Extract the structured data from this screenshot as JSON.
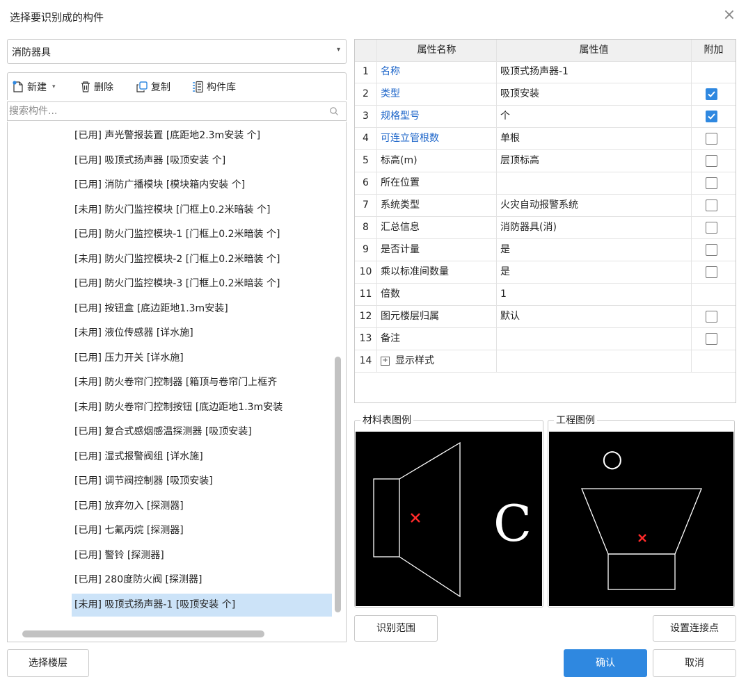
{
  "dialog": {
    "title": "选择要识别成的构件",
    "close_icon": "×"
  },
  "category": {
    "value": "消防器具"
  },
  "toolbar": {
    "new": "新建",
    "delete": "删除",
    "copy": "复制",
    "library": "构件库"
  },
  "search": {
    "placeholder": "搜索构件..."
  },
  "list": [
    "[已用] 声光警报装置 [底距地2.3m安装 个]",
    "[已用] 吸顶式扬声器 [吸顶安装 个]",
    "[已用] 消防广播模块 [模块箱内安装 个]",
    "[未用] 防火门监控模块 [门框上0.2米暗装 个]",
    "[已用] 防火门监控模块-1 [门框上0.2米暗装 个]",
    "[未用] 防火门监控模块-2 [门框上0.2米暗装 个]",
    "[已用] 防火门监控模块-3 [门框上0.2米暗装 个]",
    "[已用] 按钮盒 [底边距地1.3m安装]",
    "[未用] 液位传感器 [详水施]",
    "[已用] 压力开关 [详水施]",
    "[未用] 防火卷帘门控制器 [箱顶与卷帘门上框齐",
    "[未用] 防火卷帘门控制按钮 [底边距地1.3m安装",
    "[已用] 复合式感烟感温探测器 [吸顶安装]",
    "[已用] 湿式报警阀组 [详水施]",
    "[已用] 调节阀控制器 [吸顶安装]",
    "[已用] 放弃勿入 [探测器]",
    "[已用] 七氟丙烷 [探测器]",
    "[已用] 警铃 [探测器]",
    "[已用] 280度防火阀 [探测器]",
    "[未用] 吸顶式扬声器-1 [吸顶安装 个]"
  ],
  "selected_index": 19,
  "table": {
    "headers": {
      "name": "属性名称",
      "value": "属性值",
      "extra": "附加"
    },
    "rows": [
      {
        "no": "1",
        "name": "名称",
        "value": "吸顶式扬声器-1",
        "blue": true,
        "check": null
      },
      {
        "no": "2",
        "name": "类型",
        "value": "吸顶安装",
        "blue": true,
        "check": true
      },
      {
        "no": "3",
        "name": "规格型号",
        "value": "个",
        "blue": true,
        "check": true
      },
      {
        "no": "4",
        "name": "可连立管根数",
        "value": "单根",
        "blue": true,
        "check": false
      },
      {
        "no": "5",
        "name": "标高(m)",
        "value": "层顶标高",
        "blue": false,
        "check": false
      },
      {
        "no": "6",
        "name": "所在位置",
        "value": "",
        "blue": false,
        "check": false
      },
      {
        "no": "7",
        "name": "系统类型",
        "value": "火灾自动报警系统",
        "blue": false,
        "check": false
      },
      {
        "no": "8",
        "name": "汇总信息",
        "value": "消防器具(消)",
        "blue": false,
        "check": false
      },
      {
        "no": "9",
        "name": "是否计量",
        "value": "是",
        "blue": false,
        "check": false
      },
      {
        "no": "10",
        "name": "乘以标准间数量",
        "value": "是",
        "blue": false,
        "check": false
      },
      {
        "no": "11",
        "name": "倍数",
        "value": "1",
        "blue": false,
        "check": null
      },
      {
        "no": "12",
        "name": "图元楼层归属",
        "value": "默认",
        "blue": false,
        "check": false
      },
      {
        "no": "13",
        "name": "备注",
        "value": "",
        "blue": false,
        "check": false
      },
      {
        "no": "14",
        "name": "显示样式",
        "value": "",
        "blue": false,
        "check": null,
        "expandable": true
      }
    ]
  },
  "legend_material": {
    "label": "材料表图例",
    "glyph": "C"
  },
  "legend_project": {
    "label": "工程图例",
    "glyph": "○"
  },
  "buttons": {
    "range": "识别范围",
    "set_point": "设置连接点",
    "select_floor": "选择楼层",
    "ok": "确认",
    "cancel": "取消"
  },
  "colors": {
    "primary": "#2f88e0",
    "link": "#1a63c8",
    "selection": "#cce3f8",
    "marker": "#ff2a2a"
  }
}
